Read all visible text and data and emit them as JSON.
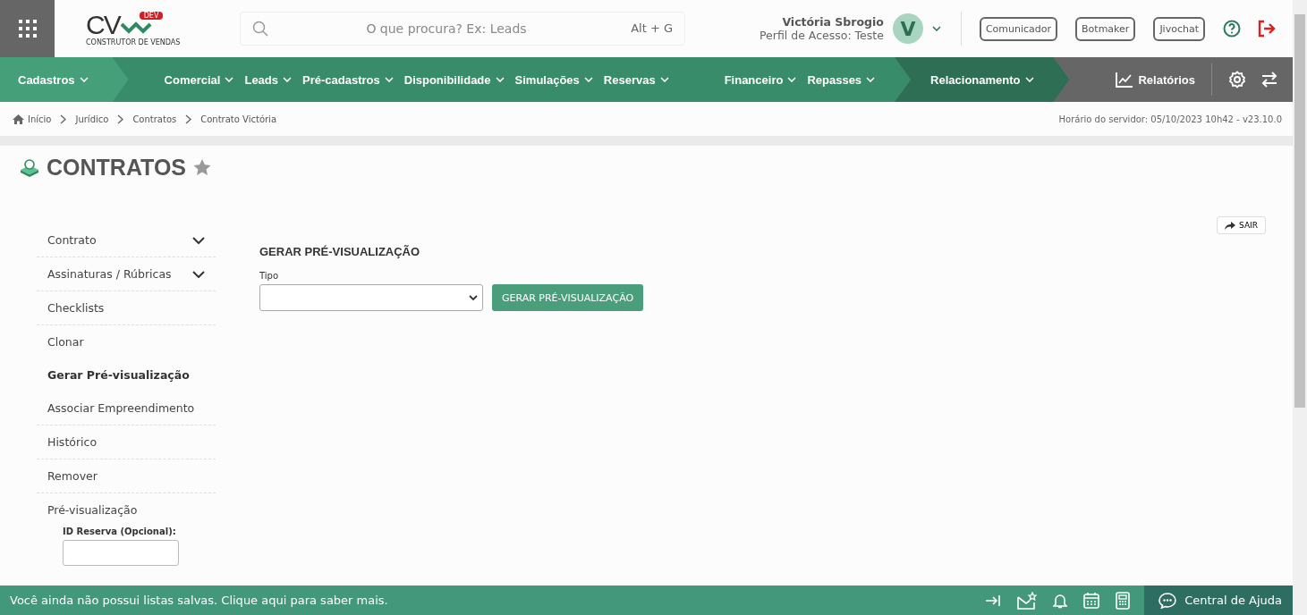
{
  "header": {
    "logo_text": "CV",
    "logo_badge": "DEV",
    "logo_subtitle": "CONSTRUTOR DE VENDAS",
    "search": {
      "placeholder": "O que procura? Ex: Leads",
      "shortcut": "Alt + G"
    },
    "user": {
      "name": "Victória Sbrogio",
      "profile": "Perfil de Acesso: Teste",
      "initial": "V"
    },
    "buttons": [
      "Comunicador",
      "Botmaker",
      "Jivochat"
    ]
  },
  "nav": [
    {
      "kind": "light",
      "items": [
        "Cadastros"
      ]
    },
    {
      "kind": "main",
      "items": [
        "Comercial",
        "Leads",
        "Pré-cadastros",
        "Disponibilidade",
        "Simulações",
        "Reservas"
      ]
    },
    {
      "kind": "main",
      "items": [
        "Financeiro",
        "Repasses"
      ]
    },
    {
      "kind": "dark",
      "items": [
        "Relacionamento"
      ]
    }
  ],
  "reports": "Relatórios",
  "breadcrumb": [
    "Início",
    "Jurídico",
    "Contratos",
    "Contrato Victória"
  ],
  "server_time": "Horário do servidor: 05/10/2023 10h42 - v23.10.0",
  "page_title": "CONTRATOS",
  "exit_button": "SAIR",
  "sidebar": [
    {
      "label": "Contrato",
      "expandable": true,
      "selected": false
    },
    {
      "label": "Assinaturas / Rúbricas",
      "expandable": true,
      "selected": false
    },
    {
      "label": "Checklists",
      "expandable": false,
      "selected": false
    },
    {
      "label": "Clonar",
      "expandable": false,
      "selected": false
    },
    {
      "label": "Gerar Pré-visualização",
      "expandable": false,
      "selected": true
    },
    {
      "label": "Associar Empreendimento",
      "expandable": false,
      "selected": false
    },
    {
      "label": "Histórico",
      "expandable": false,
      "selected": false
    },
    {
      "label": "Remover",
      "expandable": false,
      "selected": false
    },
    {
      "label": "Pré-visualização",
      "expandable": false,
      "selected": false,
      "field_label": "ID Reserva (Opcional):"
    }
  ],
  "form": {
    "title": "GERAR PRÉ-VISUALIZAÇÃO",
    "type_label": "Tipo",
    "submit": "GERAR PRÉ-VISUALIZAÇÃO"
  },
  "footer": {
    "message": "Você ainda não possui listas salvas. Clique aqui para saber mais.",
    "help": "Central de Ajuda"
  }
}
